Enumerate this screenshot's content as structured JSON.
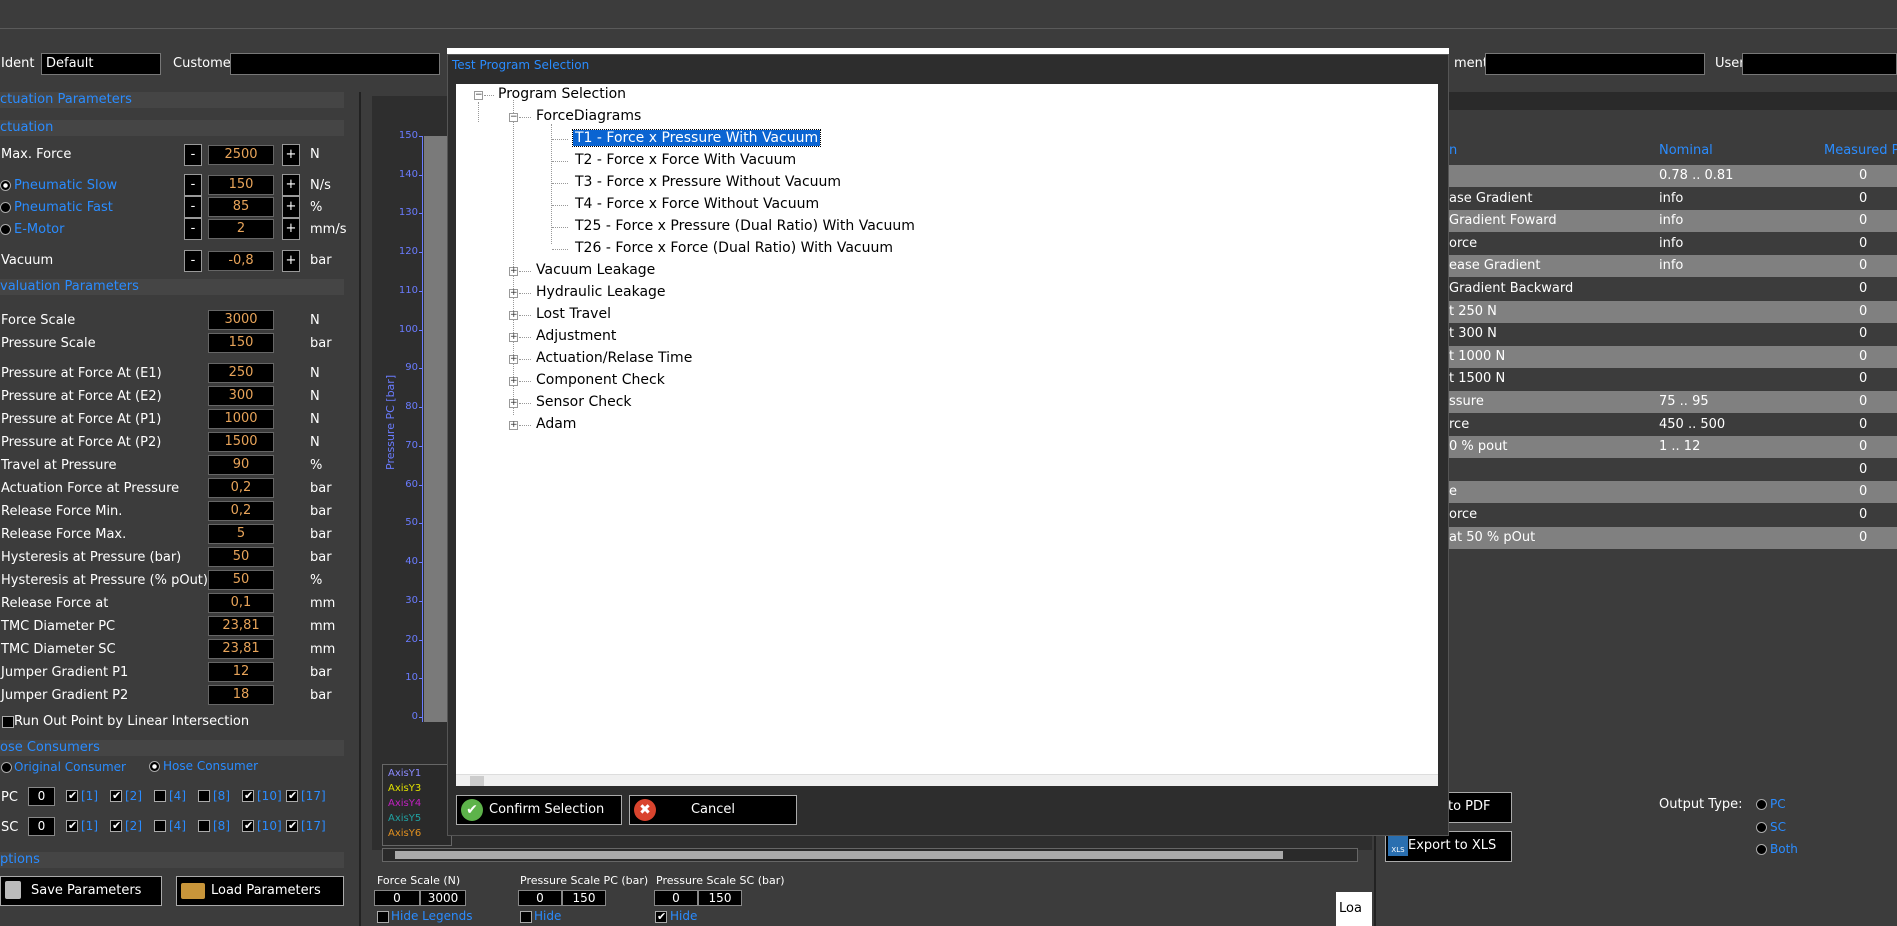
{
  "header": {
    "ident_label": "Ident",
    "ident_value": "Default",
    "customer_label": "Customer",
    "customer_value": "",
    "ment_label": "ment",
    "ment_value": "",
    "user_label": "User",
    "user_value": ""
  },
  "actuation": {
    "section_title": "ctuation Parameters",
    "sub_title": "ctuation",
    "max_force": {
      "label": "Max. Force",
      "value": "2500",
      "unit": "N"
    },
    "pneumatic_slow": {
      "label": "Pneumatic Slow",
      "value": "150",
      "unit": "N/s"
    },
    "pneumatic_fast": {
      "label": "Pneumatic Fast",
      "value": "85",
      "unit": "%"
    },
    "e_motor": {
      "label": "E-Motor",
      "value": "2",
      "unit": "mm/s"
    },
    "vacuum": {
      "label": "Vacuum",
      "value": "-0,8",
      "unit": "bar"
    },
    "minus": "-",
    "plus": "+"
  },
  "evaluation": {
    "section_title": "valuation Parameters",
    "rows": [
      {
        "label": "Force Scale",
        "value": "3000",
        "unit": "N"
      },
      {
        "label": "Pressure Scale",
        "value": "150",
        "unit": "bar"
      },
      {
        "label": "Pressure at Force At (E1)",
        "value": "250",
        "unit": "N"
      },
      {
        "label": "Pressure at Force At (E2)",
        "value": "300",
        "unit": "N"
      },
      {
        "label": "Pressure at Force At (P1)",
        "value": "1000",
        "unit": "N"
      },
      {
        "label": "Pressure at Force At (P2)",
        "value": "1500",
        "unit": "N"
      },
      {
        "label": "Travel at Pressure",
        "value": "90",
        "unit": "%"
      },
      {
        "label": "Actuation Force at Pressure",
        "value": "0,2",
        "unit": "bar"
      },
      {
        "label": "Release Force Min.",
        "value": "0,2",
        "unit": "bar"
      },
      {
        "label": "Release Force Max.",
        "value": "5",
        "unit": "bar"
      },
      {
        "label": "Hysteresis at Pressure (bar)",
        "value": "50",
        "unit": "bar"
      },
      {
        "label": "Hysteresis at Pressure (% pOut)",
        "value": "50",
        "unit": "%"
      },
      {
        "label": "Release Force at",
        "value": "0,1",
        "unit": "mm"
      },
      {
        "label": "TMC Diameter PC",
        "value": "23,81",
        "unit": "mm"
      },
      {
        "label": "TMC Diameter SC",
        "value": "23,81",
        "unit": "mm"
      },
      {
        "label": "Jumper Gradient P1",
        "value": "12",
        "unit": "bar"
      },
      {
        "label": "Jumper Gradient P2",
        "value": "18",
        "unit": "bar"
      }
    ],
    "run_out_label": "Run Out Point by Linear Intersection"
  },
  "hose": {
    "section_title": "ose Consumers",
    "original_label": "Original Consumer",
    "hose_label": "Hose Consumer",
    "pc_label": "PC",
    "sc_label": "SC",
    "pc_value": "0",
    "sc_value": "0",
    "items": [
      "[1]",
      "[2]",
      "[4]",
      "[8]",
      "[10]",
      "[17]"
    ]
  },
  "options": {
    "section_title": "ptions",
    "save_label": "Save Parameters",
    "load_label": "Load Parameters"
  },
  "chart": {
    "ylabel": "Pressure PC [bar]",
    "yticks": [
      "150",
      "140",
      "130",
      "120",
      "110",
      "100",
      "90",
      "80",
      "70",
      "60",
      "50",
      "40",
      "30",
      "20",
      "10",
      "0"
    ],
    "legend": [
      {
        "name": "AxisY1",
        "color": "#8a8aff"
      },
      {
        "name": "AxisY3",
        "color": "#e0e000"
      },
      {
        "name": "AxisY4",
        "color": "#c020c0"
      },
      {
        "name": "AxisY5",
        "color": "#20a0a0"
      },
      {
        "name": "AxisY6",
        "color": "#e09020"
      }
    ]
  },
  "scales": {
    "force_label": "Force Scale (N)",
    "force_min": "0",
    "force_max": "3000",
    "pc_label": "Pressure Scale PC (bar)",
    "pc_min": "0",
    "pc_max": "150",
    "sc_label": "Pressure Scale SC (bar)",
    "sc_min": "0",
    "sc_max": "150",
    "hide_legends": "Hide Legends",
    "hide": "Hide",
    "load_partial": "Loa"
  },
  "results": {
    "col_name": "n",
    "col_nominal": "Nominal",
    "col_measured": "Measured P",
    "rows": [
      {
        "name": "",
        "nominal": "0.78 .. 0.81",
        "measured": "0"
      },
      {
        "name": "ase Gradient",
        "nominal": "info",
        "measured": "0"
      },
      {
        "name": "Gradient Foward",
        "nominal": "info",
        "measured": "0"
      },
      {
        "name": "orce",
        "nominal": "info",
        "measured": "0"
      },
      {
        "name": "ease Gradient",
        "nominal": "info",
        "measured": "0"
      },
      {
        "name": "Gradient Backward",
        "nominal": "",
        "measured": "0"
      },
      {
        "name": "t 250 N",
        "nominal": "",
        "measured": "0"
      },
      {
        "name": "t 300 N",
        "nominal": "",
        "measured": "0"
      },
      {
        "name": "t 1000 N",
        "nominal": "",
        "measured": "0"
      },
      {
        "name": "t 1500 N",
        "nominal": "",
        "measured": "0"
      },
      {
        "name": "ssure",
        "nominal": "75 .. 95",
        "measured": "0"
      },
      {
        "name": "rce",
        "nominal": "450 .. 500",
        "measured": "0"
      },
      {
        "name": "0 % pout",
        "nominal": "1 .. 12",
        "measured": "0"
      },
      {
        "name": "",
        "nominal": "",
        "measured": "0"
      },
      {
        "name": "e",
        "nominal": "",
        "measured": "0"
      },
      {
        "name": "orce",
        "nominal": "",
        "measured": "0"
      },
      {
        "name": "at 50 % pOut",
        "nominal": "",
        "measured": "0"
      }
    ],
    "export_pdf": "to PDF",
    "export_xls": "Export to XLS",
    "output_type_label": "Output Type:",
    "out_pc": "PC",
    "out_sc": "SC",
    "out_both": "Both"
  },
  "dialog": {
    "title": "Test Program Selection",
    "root": "Program Selection",
    "group_open": "ForceDiagrams",
    "children": [
      "T1 - Force x Pressure With Vacuum",
      "T2 - Force x Force With Vacuum",
      "T3 - Force x Pressure Without Vacuum",
      "T4 - Force x Force Without Vacuum",
      "T25 - Force x Pressure (Dual Ratio) With Vacuum",
      "T26 - Force x Force (Dual Ratio) With Vacuum"
    ],
    "groups": [
      "Vacuum Leakage",
      "Hydraulic Leakage",
      "Lost Travel",
      "Adjustment",
      "Actuation/Relase Time",
      "Component Check",
      "Sensor Check",
      "Adam"
    ],
    "confirm_label": "Confirm Selection",
    "cancel_label": "Cancel"
  }
}
